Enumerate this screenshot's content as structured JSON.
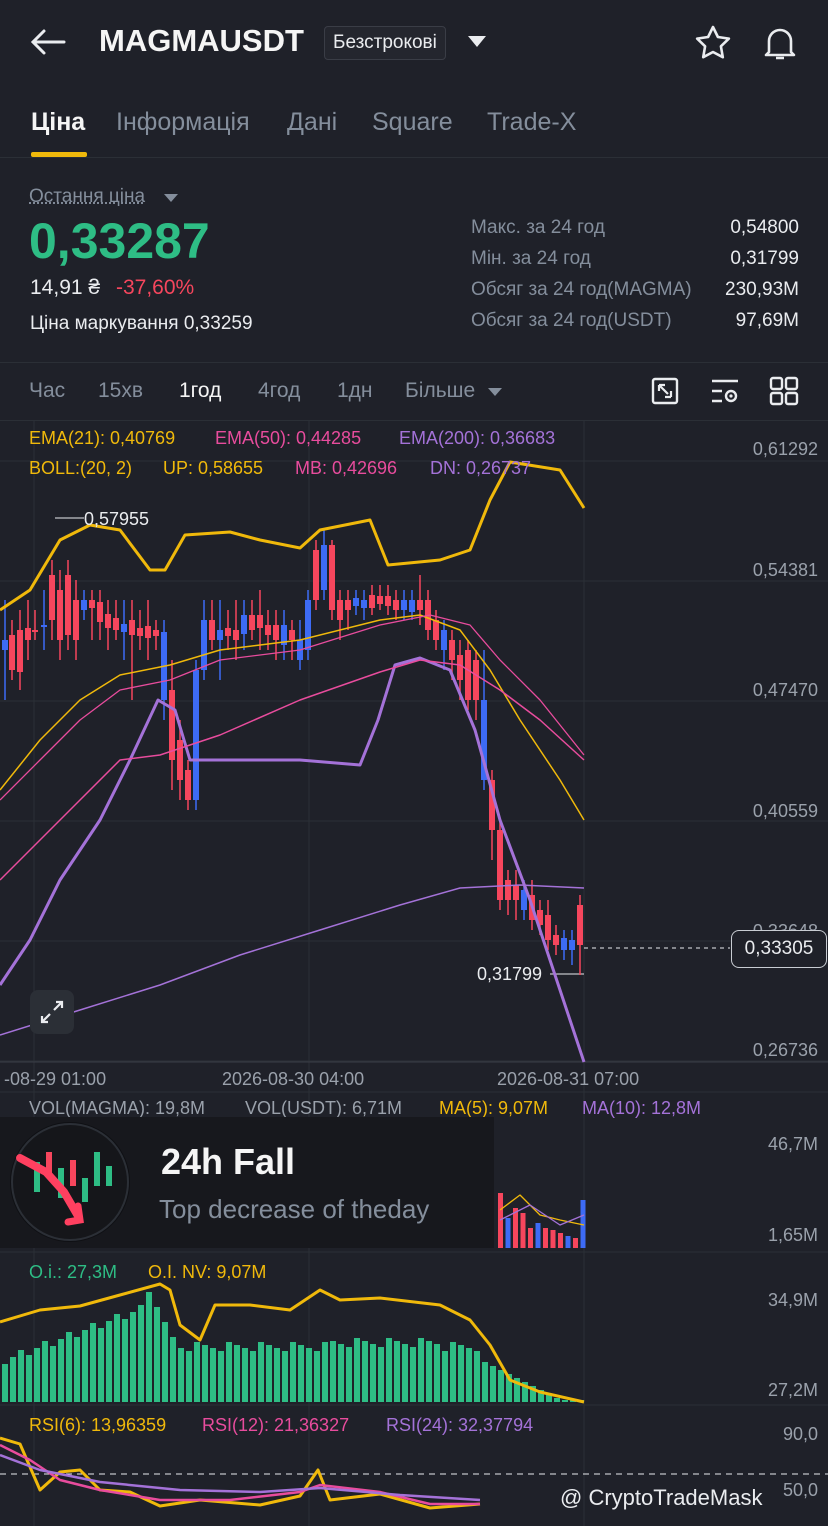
{
  "header": {
    "symbol": "MAGMAUSDT",
    "contract_type": "Безстрокові"
  },
  "tabs": [
    "Ціна",
    "Інформація",
    "Дані",
    "Square",
    "Trade-X"
  ],
  "price_block": {
    "last_price_label": "Остання ціна",
    "last_price": "0,33287",
    "fiat_value": "14,91 ₴",
    "change_pct": "-37,60%",
    "mark_price": "Ціна маркування 0,33259",
    "stats": [
      {
        "label": "Макс. за 24 год",
        "value": "0,54800"
      },
      {
        "label": "Мін. за 24 год",
        "value": "0,31799"
      },
      {
        "label": "Обсяг за 24 год(MAGMA)",
        "value": "230,93M"
      },
      {
        "label": "Обсяг за 24 год(USDT)",
        "value": "97,69M"
      }
    ]
  },
  "intervals": [
    "Час",
    "15хв",
    "1год",
    "4год",
    "1дн",
    "Більше"
  ],
  "active_interval": "1год",
  "indicators": {
    "ema21": "EMA(21): 0,40769",
    "ema50": "EMA(50): 0,44285",
    "ema200": "EMA(200): 0,36683",
    "boll": "BOLL:(20, 2)",
    "up": "UP: 0,58655",
    "mb": "MB: 0,42696",
    "dn": "DN: 0,26737"
  },
  "price_axis": [
    "0,61292",
    "0,54381",
    "0,47470",
    "0,40559",
    "0,33648",
    "0,26736"
  ],
  "current_price_tag": "0,33305",
  "high_marker": "0,57955",
  "low_marker": "0,31799",
  "time_axis": [
    "-08-29 01:00",
    "2026-08-30 04:00",
    "2026-08-31 07:00"
  ],
  "volume": {
    "vol_magma": "VOL(MAGMA): 19,8M",
    "vol_usdt": "VOL(USDT): 6,71M",
    "ma5": "MA(5): 9,07M",
    "ma10": "MA(10): 12,8M",
    "axis": [
      "46,7M",
      "1,65M"
    ]
  },
  "oi": {
    "oi": "O.i.: 27,3M",
    "oi_nv": "O.I. NV: 9,07M",
    "axis": [
      "34,9M",
      "27,2M"
    ]
  },
  "rsi": {
    "rsi6": "RSI(6): 13,96359",
    "rsi12": "RSI(12): 21,36327",
    "rsi24": "RSI(24): 32,37794",
    "axis": [
      "90,0",
      "50,0"
    ]
  },
  "promo": {
    "title": "24h Fall",
    "subtitle": "Top decrease of theday"
  },
  "watermark": "@ CryptoTradeMask",
  "colors": {
    "up": "#2ebd85",
    "down": "#f6465d",
    "accent": "#f0b90b",
    "ema50": "#e84c9d",
    "ema200": "#a472d8",
    "candle_up_blue": "#3d6bf5"
  }
}
